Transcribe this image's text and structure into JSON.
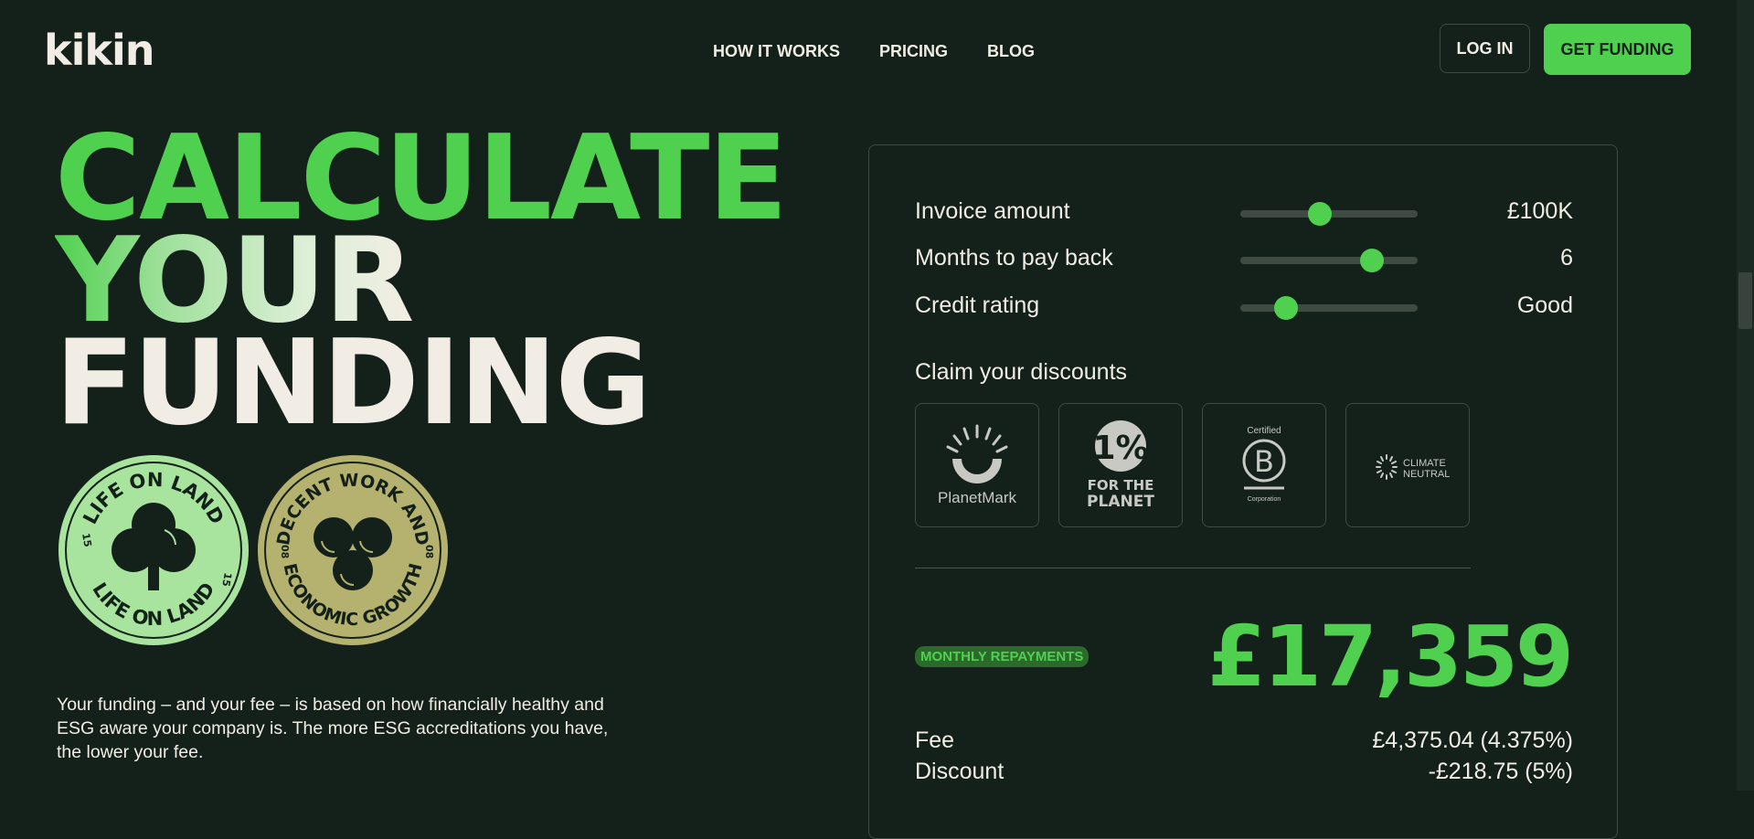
{
  "nav": {
    "logo": "kikin",
    "links": [
      "HOW IT WORKS",
      "PRICING",
      "BLOG"
    ],
    "login": "LOG IN",
    "cta": "GET FUNDING"
  },
  "hero": {
    "line1": "CALCULATE",
    "line2": "YOUR",
    "line3": "FUNDING"
  },
  "badges": [
    {
      "top": "LIFE ON LAND",
      "bottom": "LIFE ON LAND",
      "number": "15"
    },
    {
      "top": "DECENT WORK AND",
      "bottom": "ECONOMIC GROWTH",
      "number": "08"
    }
  ],
  "blurb": "Your funding – and your fee – is based on how financially healthy and ESG aware your company is. The more ESG accreditations you have, the lower your fee.",
  "calculator": {
    "sliders": [
      {
        "label": "Invoice amount",
        "value": "£100K",
        "level": 0.45
      },
      {
        "label": "Months to pay back",
        "value": "6",
        "level": 0.74
      },
      {
        "label": "Credit rating",
        "value": "Good",
        "level": 0.26
      }
    ],
    "discounts_title": "Claim your discounts",
    "discounts": [
      {
        "name": "planet-mark",
        "text": "PlanetMark"
      },
      {
        "name": "one-percent-for-the-planet",
        "line1": "FOR THE",
        "line2": "PLANET",
        "mark": "1%"
      },
      {
        "name": "b-corp",
        "line1": "Certified",
        "line2": "Corporation",
        "mark": "B"
      },
      {
        "name": "climate-neutral",
        "line1": "CLIMATE",
        "line2": "NEUTRAL"
      }
    ],
    "monthly_label": "MONTHLY REPAYMENTS",
    "monthly_value": "£17,359",
    "fee_label": "Fee",
    "fee_value": "£4,375.04 (4.375%)",
    "discount_label": "Discount",
    "discount_value": "-£218.75 (5%)"
  },
  "colors": {
    "background": "#13211a",
    "accent": "#4fd14f",
    "cream": "#f2ede4",
    "badge_green": "#a8e49e",
    "badge_gold": "#b5b26f"
  }
}
